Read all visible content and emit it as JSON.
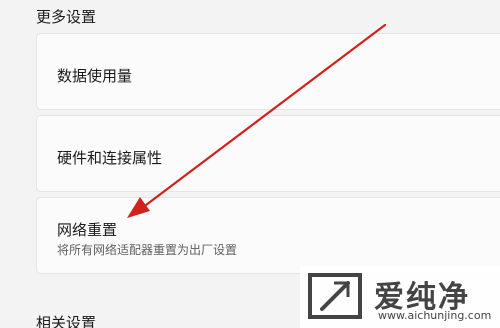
{
  "more_settings": {
    "title": "更多设置",
    "items": [
      {
        "label": "数据使用量"
      },
      {
        "label": "硬件和连接属性"
      },
      {
        "label": "网络重置",
        "description": "将所有网络适配器重置为出厂设置"
      }
    ]
  },
  "related_settings": {
    "title": "相关设置"
  },
  "annotation": {
    "arrow_color": "#d0221c"
  },
  "watermark": {
    "brand": "爱纯净",
    "url": "www.aichunjing.com"
  }
}
